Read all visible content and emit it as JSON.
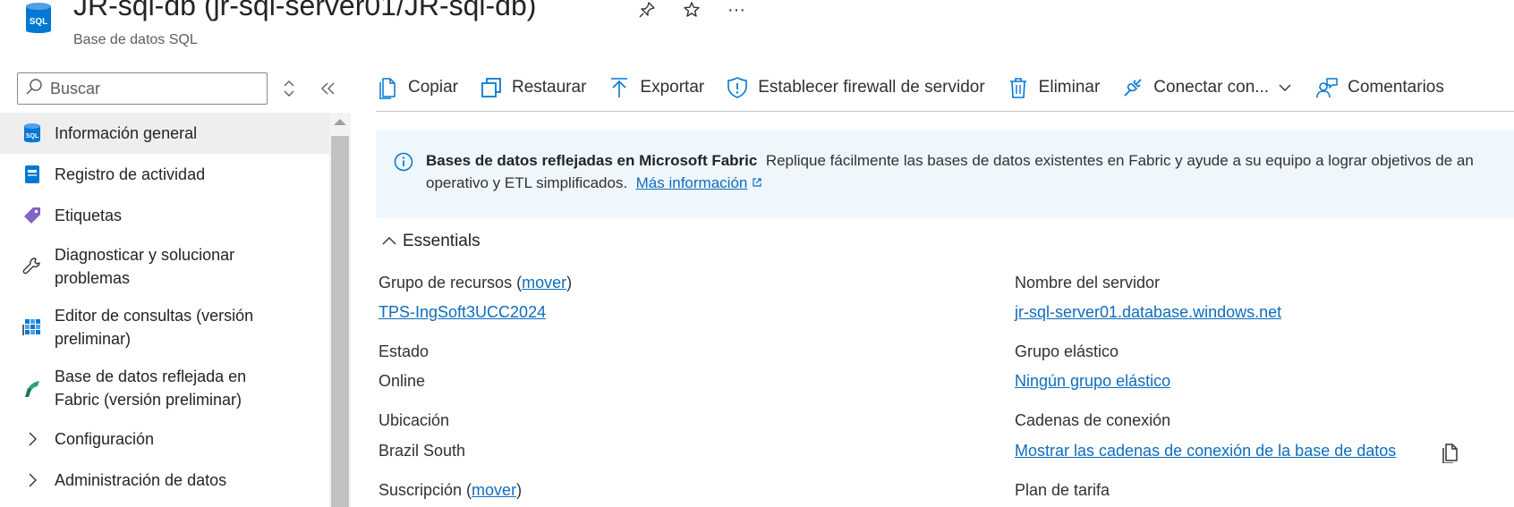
{
  "header": {
    "title": "JR-sql-db (jr-sql-server01/JR-sql-db)",
    "subtitle": "Base de datos SQL",
    "resource_icon_text": "SQL",
    "more_label": "···"
  },
  "sidebar": {
    "search_placeholder": "Buscar",
    "items": [
      {
        "label": "Información general",
        "icon": "sql-database-icon",
        "active": true
      },
      {
        "label": "Registro de actividad",
        "icon": "activity-log-icon"
      },
      {
        "label": "Etiquetas",
        "icon": "tag-icon"
      },
      {
        "label": "Diagnosticar y solucionar problemas",
        "icon": "wrench-icon"
      },
      {
        "label": "Editor de consultas (versión preliminar)",
        "icon": "query-editor-icon"
      },
      {
        "label": "Base de datos reflejada en Fabric (versión preliminar)",
        "icon": "fabric-icon"
      },
      {
        "label": "Configuración",
        "icon": "chevron-right-icon"
      },
      {
        "label": "Administración de datos",
        "icon": "chevron-right-icon"
      }
    ]
  },
  "toolbar": {
    "copy": "Copiar",
    "restore": "Restaurar",
    "export": "Exportar",
    "firewall": "Establecer firewall de servidor",
    "delete": "Eliminar",
    "connect": "Conectar con...",
    "feedback": "Comentarios"
  },
  "banner": {
    "title": "Bases de datos reflejadas en Microsoft Fabric",
    "text_line1": "Replique fácilmente las bases de datos existentes en Fabric y ayude a su equipo a lograr objetivos de an",
    "text_line2": "operativo y ETL simplificados.",
    "link": "Más información"
  },
  "essentials": {
    "title": "Essentials",
    "left": {
      "resource_group_label": "Grupo de recursos (",
      "move_link": "mover",
      "close_paren": ")",
      "resource_group_value": "TPS-IngSoft3UCC2024",
      "status_label": "Estado",
      "status_value": "Online",
      "location_label": "Ubicación",
      "location_value": "Brazil South",
      "subscription_label": "Suscripción (",
      "subscription_move": "mover",
      "subscription_close": ")"
    },
    "right": {
      "server_label": "Nombre del servidor",
      "server_value": "jr-sql-server01.database.windows.net",
      "elastic_label": "Grupo elástico",
      "elastic_value": "Ningún grupo elástico",
      "conn_label": "Cadenas de conexión",
      "conn_value": "Mostrar las cadenas de conexión de la base de datos",
      "pricing_label": "Plan de tarifa"
    }
  },
  "colors": {
    "link": "#0f6cbd",
    "accent": "#0078d4",
    "banner_bg": "#eff6fc"
  }
}
